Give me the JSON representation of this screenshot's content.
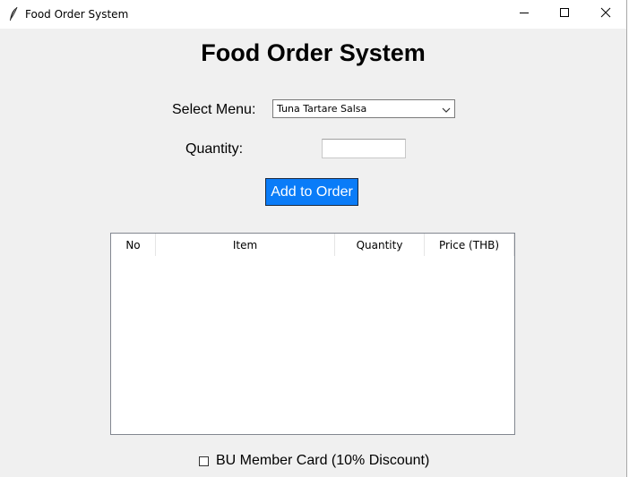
{
  "window": {
    "title": "Food Order System",
    "icon": "feather-icon"
  },
  "titlebar_buttons": [
    "minimize-icon",
    "maximize-icon",
    "close-icon"
  ],
  "heading": "Food Order System",
  "form": {
    "menu_label": "Select Menu:",
    "menu_selected": "Tuna Tartare Salsa",
    "quantity_label": "Quantity:",
    "quantity_value": "",
    "add_button": "Add to Order"
  },
  "order_table": {
    "columns": [
      "No",
      "Item",
      "Quantity",
      "Price (THB)"
    ],
    "rows": []
  },
  "member_card": {
    "label": "BU Member Card (10% Discount)",
    "checked": false
  },
  "colors": {
    "accent_button": "#0a7cf8",
    "window_bg": "#f0f0f0"
  }
}
